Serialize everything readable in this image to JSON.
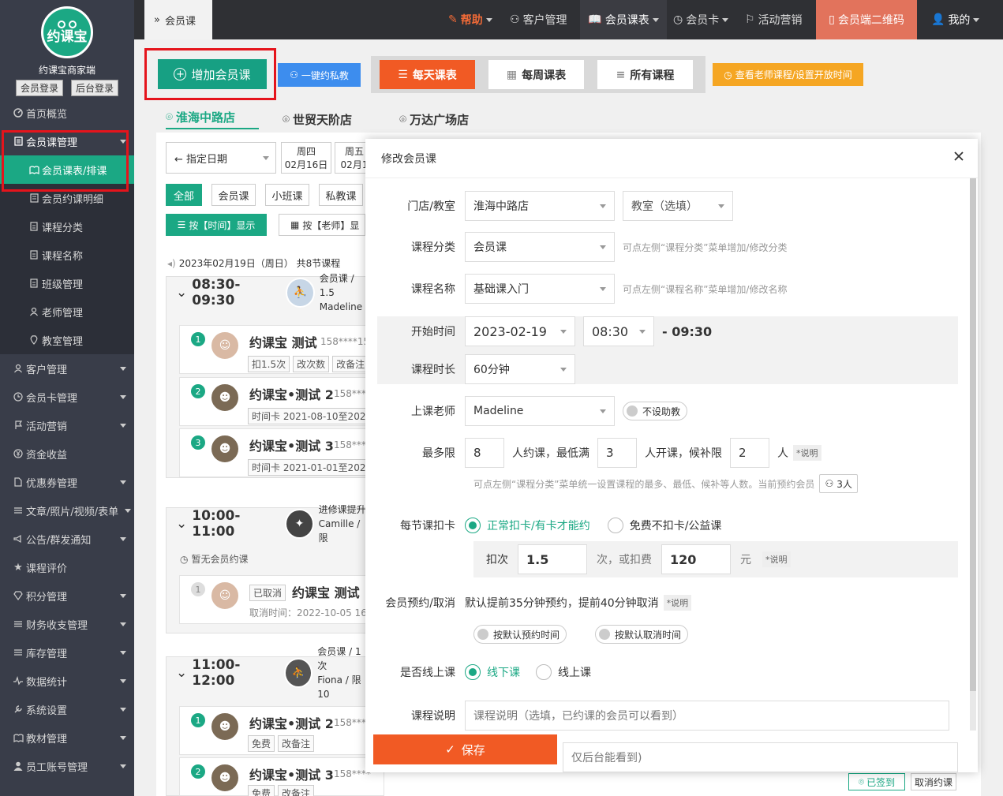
{
  "sidebar": {
    "brand_logo_text": "约课宝",
    "brand_name": "约课宝商家端",
    "member_login": "会员登录",
    "admin_login": "后台登录",
    "items": [
      {
        "label": "首页概览"
      },
      {
        "label": "会员课管理"
      },
      {
        "label": "会员课表/排课"
      },
      {
        "label": "会员约课明细"
      },
      {
        "label": "课程分类"
      },
      {
        "label": "课程名称"
      },
      {
        "label": "班级管理"
      },
      {
        "label": "老师管理"
      },
      {
        "label": "教室管理"
      },
      {
        "label": "客户管理"
      },
      {
        "label": "会员卡管理"
      },
      {
        "label": "活动营销"
      },
      {
        "label": "资金收益"
      },
      {
        "label": "优惠券管理"
      },
      {
        "label": "文章/照片/视频/表单"
      },
      {
        "label": "公告/群发通知"
      },
      {
        "label": "课程评价"
      },
      {
        "label": "积分管理"
      },
      {
        "label": "财务收支管理"
      },
      {
        "label": "库存管理"
      },
      {
        "label": "数据统计"
      },
      {
        "label": "系统设置"
      },
      {
        "label": "教材管理"
      },
      {
        "label": "员工账号管理"
      }
    ]
  },
  "topbar": {
    "breadcrumb": "会员课",
    "help": "帮助",
    "customers": "客户管理",
    "schedule": "会员课表",
    "member_card": "会员卡",
    "marketing": "活动营销",
    "qrcode": "会员端二维码",
    "mine": "我的"
  },
  "toolbar": {
    "add_course": "增加会员课",
    "private_booking": "一键约私教",
    "daily": "每天课表",
    "weekly": "每周课表",
    "all_courses": "所有课程",
    "teacher_view": "查看老师课程/设置开放时间"
  },
  "stores": [
    "淮海中路店",
    "世贸天阶店",
    "万达广场店"
  ],
  "schedule_bg": {
    "date_picker": "← 指定日期",
    "days": [
      {
        "w": "周四",
        "d": "02月16日"
      },
      {
        "w": "周五",
        "d": "02月1"
      }
    ],
    "filters": [
      "全部",
      "会员课",
      "小班课",
      "私教课"
    ],
    "by_time": "按【时间】显示",
    "by_teacher": "按【老师】显",
    "summary": "2023年02月19日（周日） 共8节课程",
    "sessions": [
      {
        "time": "08:30-09:30",
        "type": "会员课 / 1.5",
        "teacher": "Madeline (",
        "members": [
          {
            "num": "1",
            "name": "约课宝 测试",
            "phone": "158****15",
            "tags": [
              "扣1.5次",
              "改次数",
              "改备注"
            ]
          },
          {
            "num": "2",
            "name": "约课宝•测试 2",
            "phone": "158****",
            "tags": [
              "时间卡 2021-08-10至2022"
            ]
          },
          {
            "num": "3",
            "name": "约课宝•测试 3",
            "phone": "158****",
            "tags": [
              "时间卡 2021-01-01至2022"
            ]
          }
        ]
      },
      {
        "time": "10:00-11:00",
        "type": "进修课提升",
        "teacher": "Camille / 限",
        "empty": "暂无会员约课",
        "cancelled": {
          "num": "1",
          "status": "已取消",
          "name": "约课宝 测试",
          "time": "取消时间：2022-10-05 16:"
        }
      },
      {
        "time": "11:00-12:00",
        "type": "会员课 / 1次",
        "teacher": "Fiona / 限10",
        "members": [
          {
            "num": "1",
            "name": "约课宝•测试 2",
            "phone": "158****",
            "tags": [
              "免费",
              "改备注"
            ]
          },
          {
            "num": "2",
            "name": "约课宝•测试 3",
            "phone": "158****",
            "tags": [
              "免费",
              "改备注"
            ]
          }
        ]
      }
    ],
    "signed": "已签到",
    "cancel_booking": "取消约课"
  },
  "modal": {
    "title": "修改会员课",
    "store_label": "门店/教室",
    "store_value": "淮海中路店",
    "room_value": "教室（选填）",
    "category_label": "课程分类",
    "category_value": "会员课",
    "category_hint": "可点左侧“课程分类”菜单增加/修改分类",
    "name_label": "课程名称",
    "name_value": "基础课入门",
    "name_hint": "可点左侧“课程名称”菜单增加/修改名称",
    "start_label": "开始时间",
    "start_date": "2023-02-19",
    "start_time": "08:30",
    "end_time": "- 09:30",
    "duration_label": "课程时长",
    "duration_value": "60分钟",
    "teacher_label": "上课老师",
    "teacher_value": "Madeline",
    "assistant_toggle": "不设助教",
    "limit_label": "最多限",
    "max_num": "8",
    "max_text": "人约课，最低满",
    "min_num": "3",
    "min_text": "人开课，候补限",
    "wait_num": "2",
    "wait_text": "人",
    "explain": "*说明",
    "limit_hint": "可点左侧“课程分类”菜单统一设置课程的最多、最低、候补等人数。当前预约会员",
    "current_members": "3人",
    "deduct_label": "每节课扣卡",
    "deduct_opt1": "正常扣卡/有卡才能约",
    "deduct_opt2": "免费不扣卡/公益课",
    "deduct_times_label": "扣次",
    "deduct_times": "1.5",
    "deduct_or": "次，或扣费",
    "deduct_fee": "120",
    "deduct_unit": "元",
    "booking_label": "会员预约/取消",
    "booking_text": "默认提前35分钟预约，提前40分钟取消",
    "booking_default": "按默认预约时间",
    "cancel_default": "按默认取消时间",
    "online_label": "是否线上课",
    "offline_opt": "线下课",
    "online_opt": "线上课",
    "desc_label": "课程说明",
    "desc_placeholder": "课程说明（选填，已约课的会员可以看到）",
    "admin_note_placeholder": "仅后台能看到)",
    "save": "保存"
  }
}
